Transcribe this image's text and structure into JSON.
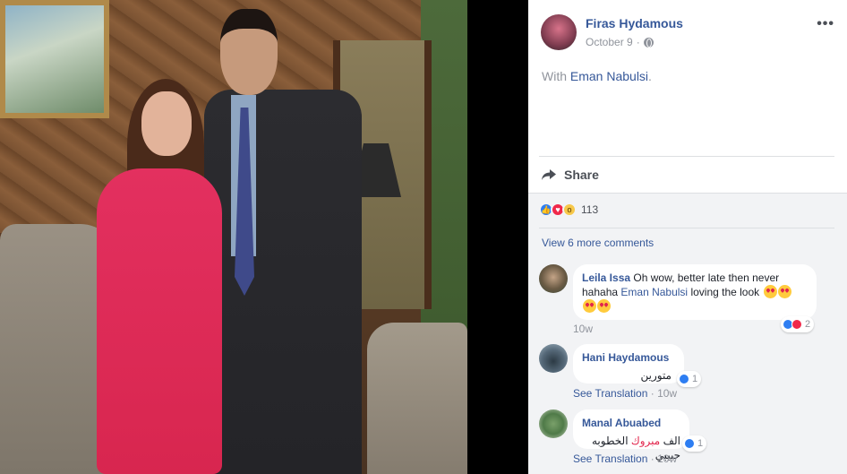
{
  "post": {
    "author": "Firas Hydamous",
    "date": "October 9",
    "separator": "·",
    "more_menu": "•••",
    "with_prefix": "With",
    "tagged": "Eman Nabulsi",
    "tag_suffix": "."
  },
  "actions": {
    "share_label": "Share"
  },
  "reactions": {
    "types": [
      "like",
      "love",
      "wow"
    ],
    "count": "113"
  },
  "view_more": "View 6 more comments",
  "comments": [
    {
      "name": "Leila Issa",
      "text_a": "Oh wow, better late then never",
      "text_b": "hahaha",
      "mention": "Eman Nabulsi",
      "text_c": "loving the look",
      "reaction_count": "2",
      "time": "10w"
    },
    {
      "name": "Hani Haydamous",
      "text": "متورين",
      "reaction_count": "1",
      "translate": "See Translation",
      "dot": "·",
      "time": "10w"
    },
    {
      "name": "Manal Abuabed",
      "text_a": "الف",
      "text_red": "مبروك",
      "text_b": "الخطوبه حبيبي",
      "reaction_count": "1",
      "translate": "See Translation",
      "dot": "·",
      "time": "10w"
    }
  ],
  "colors": {
    "link": "#365899",
    "muted": "#90949c",
    "like": "#2e7ef2",
    "love": "#f0284a",
    "wow": "#f7c849"
  }
}
